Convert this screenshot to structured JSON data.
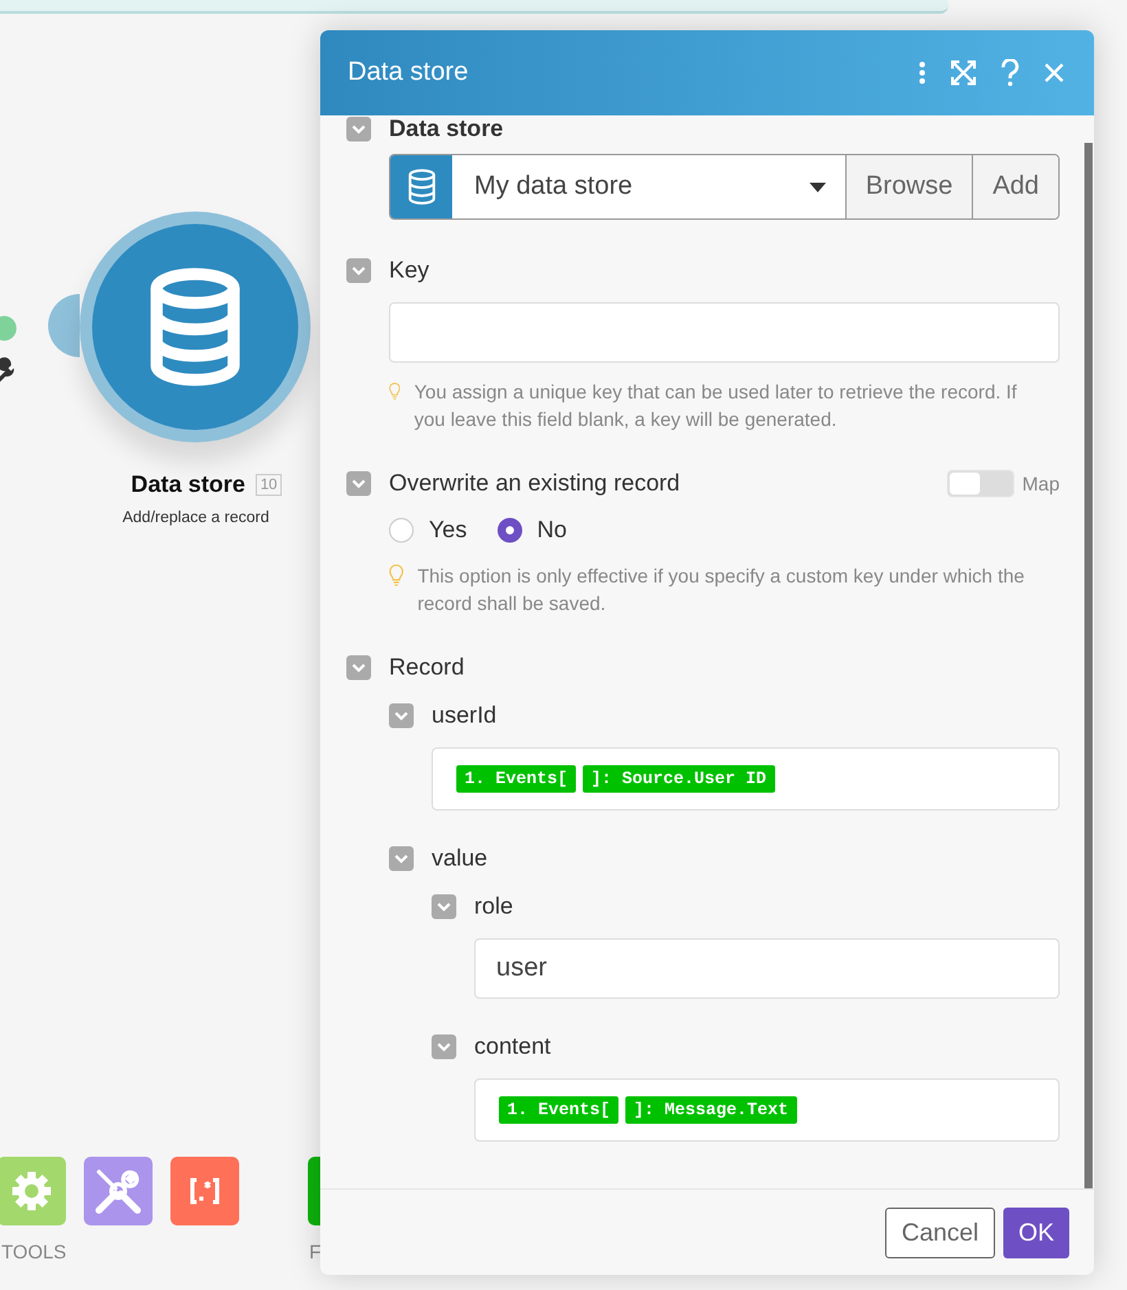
{
  "canvas": {
    "module": {
      "title": "Data store",
      "badge": "10",
      "subtitle": "Add/replace a record"
    },
    "toolbar": {
      "items": [
        {
          "kind": "gear",
          "color": "#a3d86d"
        },
        {
          "kind": "tools",
          "color": "#ab94ec"
        },
        {
          "kind": "regex",
          "color": "#ff7058"
        }
      ],
      "label": "TOOLS",
      "next_label": "F"
    }
  },
  "dialog": {
    "title": "Data store",
    "fields": [
      {
        "kind": "select",
        "label": "Data store",
        "bold": true,
        "expanded": true,
        "value": "My data store",
        "buttons": [
          "Browse",
          "Add"
        ]
      },
      {
        "kind": "text",
        "label": "Key",
        "expanded": true,
        "hint": "You assign a unique key that can be used later to retrieve the record. If you leave this field blank, a key will be generated."
      },
      {
        "kind": "radio",
        "label": "Overwrite an existing record",
        "expanded": true,
        "map": {
          "label": "Map",
          "on": false
        },
        "options": [
          {
            "label": "Yes",
            "selected": false
          },
          {
            "label": "No",
            "selected": true
          }
        ],
        "hint": "This option is only effective if you specify a custom key under which the record shall be saved."
      },
      {
        "kind": "group",
        "label": "Record",
        "expanded": true,
        "children": [
          {
            "kind": "tokens",
            "label": "userId",
            "expanded": true,
            "tokens": [
              "1. Events[",
              "]: Source.User ID"
            ]
          },
          {
            "kind": "group",
            "label": "value",
            "expanded": true,
            "children": [
              {
                "kind": "text",
                "label": "role",
                "expanded": true,
                "value": "user"
              },
              {
                "kind": "tokens",
                "label": "content",
                "expanded": true,
                "tokens": [
                  "1. Events[",
                  "]: Message.Text"
                ]
              }
            ]
          }
        ]
      }
    ],
    "buttons": {
      "cancel": "Cancel",
      "ok": "OK"
    }
  }
}
